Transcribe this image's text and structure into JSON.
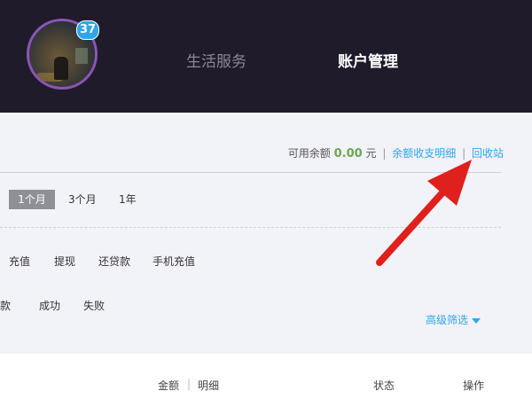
{
  "header": {
    "badge_count": "37",
    "nav": {
      "life_services": "生活服务",
      "account_management": "账户管理"
    }
  },
  "balance": {
    "label": "可用余额",
    "amount": "0.00",
    "unit": "元",
    "separator": "|",
    "details_link": "余额收支明细",
    "recycle_link": "回收站"
  },
  "period_filters": {
    "one_month": "1个月",
    "three_months": "3个月",
    "one_year": "1年"
  },
  "type_filters": [
    "充值",
    "提现",
    "还贷款",
    "手机充值"
  ],
  "status_filters": [
    "退款",
    "成功",
    "失败"
  ],
  "advanced_filter": "高级筛选",
  "table_header": {
    "amount": "金额",
    "separator": "|",
    "detail": "明细",
    "status": "状态",
    "action": "操作"
  },
  "colors": {
    "header_bg": "#1f1b2a",
    "panel_bg": "#f2f2f9",
    "link": "#2ea7e9",
    "amount": "#6aa84f",
    "arrow": "#e0201c"
  }
}
